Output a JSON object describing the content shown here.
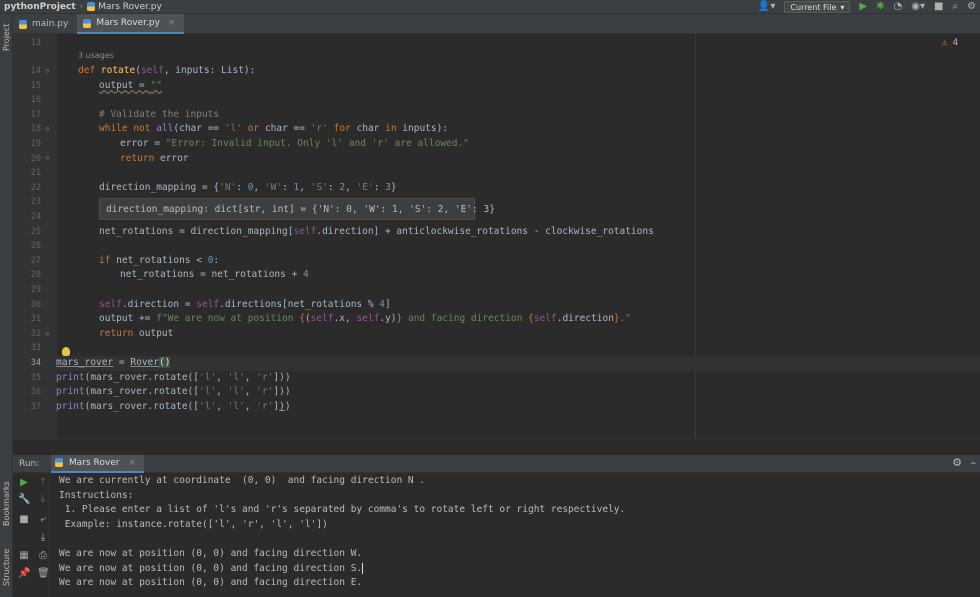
{
  "titlebar": {
    "project": "pythonProject",
    "file": "Mars Rover.py",
    "run_config": "Current File"
  },
  "tabs": [
    {
      "label": "main.py"
    },
    {
      "label": "Mars Rover.py"
    }
  ],
  "sidebar": {
    "project": "Project",
    "bookmarks": "Bookmarks",
    "structure": "Structure"
  },
  "editor": {
    "usages": "3 usages",
    "warnings_count": "4",
    "line_numbers": [
      "13",
      "14",
      "15",
      "16",
      "17",
      "18",
      "19",
      "20",
      "21",
      "22",
      "23",
      "24",
      "25",
      "26",
      "27",
      "28",
      "29",
      "30",
      "31",
      "32",
      "33",
      "34",
      "35",
      "36",
      "37"
    ],
    "inline_hint": "direction_mapping: dict[str, int] = {'N': 0, 'W': 1, 'S': 2, 'E': 3}"
  },
  "run": {
    "label": "Run:",
    "tab": "Mars Rover",
    "output": [
      "We are currently at coordinate  (0, 0)  and facing direction N .",
      "Instructions:",
      " 1. Please enter a list of 'l's and 'r's separated by comma's to rotate left or right respectively.",
      " Example: instance.rotate(['l', 'r', 'l', 'l'])",
      "",
      "We are now at position (0, 0) and facing direction W.",
      "We are now at position (0, 0) and facing direction S.",
      "We are now at position (0, 0) and facing direction E."
    ]
  },
  "colors": {
    "background": "#2b2b2b",
    "keyword": "#cc7832",
    "function": "#ffc66d",
    "string": "#6a8759",
    "number": "#6897bb",
    "accent": "#4a88c7"
  }
}
